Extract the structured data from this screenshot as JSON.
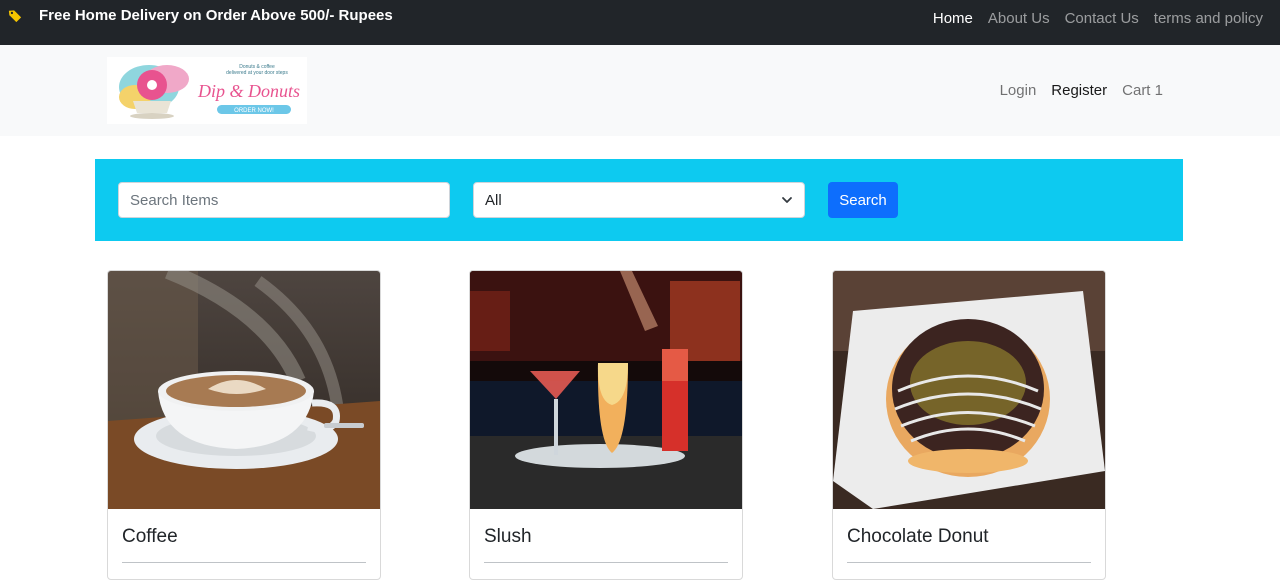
{
  "promo": {
    "text": "Free Home Delivery on Order Above 500/- Rupees",
    "icon": "tag-icon"
  },
  "topnav": [
    {
      "label": "Home",
      "active": true
    },
    {
      "label": "About Us"
    },
    {
      "label": "Contact Us"
    },
    {
      "label": "terms and policy"
    }
  ],
  "logo": {
    "tagline_1": "Donuts & coffee",
    "tagline_2": "delivered at your door steps",
    "brand": "Dip & Donuts",
    "cta": "ORDER NOW!"
  },
  "account": {
    "login": "Login",
    "register": "Register",
    "cart": "Cart 1"
  },
  "search": {
    "placeholder": "Search Items",
    "category_selected": "All",
    "button": "Search"
  },
  "products": [
    {
      "name": "Coffee"
    },
    {
      "name": "Slush"
    },
    {
      "name": "Chocolate Donut"
    }
  ],
  "colors": {
    "topbar": "#212529",
    "header": "#f8f9fa",
    "search_bar": "#0dcaf0",
    "search_button": "#0d6efd"
  }
}
